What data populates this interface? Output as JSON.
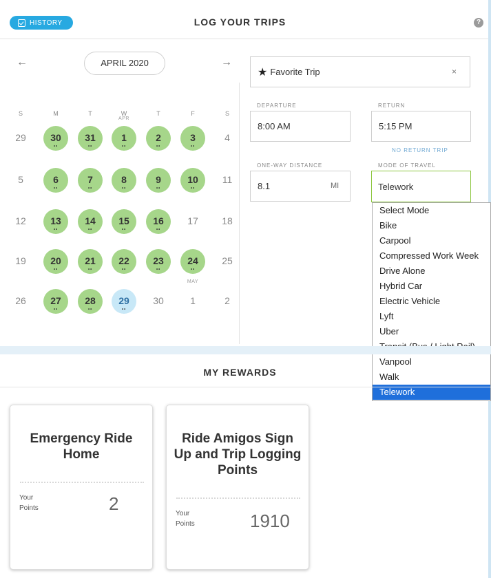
{
  "header": {
    "history_label": "HISTORY",
    "title": "LOG YOUR TRIPS",
    "help_glyph": "?"
  },
  "calendar": {
    "month_label": "APRIL 2020",
    "prev_glyph": "←",
    "next_glyph": "→",
    "weekdays": [
      "S",
      "M",
      "T",
      "W",
      "T",
      "F",
      "S"
    ],
    "logged_color": "#a6d68a",
    "today_color": "#c8e8f7",
    "weeks": [
      [
        {
          "d": "29",
          "s": "plain"
        },
        {
          "d": "30",
          "s": "logged"
        },
        {
          "d": "31",
          "s": "logged"
        },
        {
          "d": "1",
          "s": "logged",
          "m": "APR"
        },
        {
          "d": "2",
          "s": "logged"
        },
        {
          "d": "3",
          "s": "logged"
        },
        {
          "d": "4",
          "s": "plain"
        }
      ],
      [
        {
          "d": "5",
          "s": "plain"
        },
        {
          "d": "6",
          "s": "logged"
        },
        {
          "d": "7",
          "s": "logged"
        },
        {
          "d": "8",
          "s": "logged"
        },
        {
          "d": "9",
          "s": "logged"
        },
        {
          "d": "10",
          "s": "logged"
        },
        {
          "d": "11",
          "s": "plain"
        }
      ],
      [
        {
          "d": "12",
          "s": "plain"
        },
        {
          "d": "13",
          "s": "logged"
        },
        {
          "d": "14",
          "s": "logged"
        },
        {
          "d": "15",
          "s": "logged"
        },
        {
          "d": "16",
          "s": "logged"
        },
        {
          "d": "17",
          "s": "plain"
        },
        {
          "d": "18",
          "s": "plain"
        }
      ],
      [
        {
          "d": "19",
          "s": "plain"
        },
        {
          "d": "20",
          "s": "logged"
        },
        {
          "d": "21",
          "s": "logged"
        },
        {
          "d": "22",
          "s": "logged"
        },
        {
          "d": "23",
          "s": "logged"
        },
        {
          "d": "24",
          "s": "logged"
        },
        {
          "d": "25",
          "s": "plain"
        }
      ],
      [
        {
          "d": "26",
          "s": "plain"
        },
        {
          "d": "27",
          "s": "logged"
        },
        {
          "d": "28",
          "s": "logged"
        },
        {
          "d": "29",
          "s": "today"
        },
        {
          "d": "30",
          "s": "plain"
        },
        {
          "d": "1",
          "s": "plain",
          "m": "MAY"
        },
        {
          "d": "2",
          "s": "plain"
        }
      ]
    ]
  },
  "trip_form": {
    "favorite_label": "Favorite Trip",
    "favorite_clear": "×",
    "departure_label": "DEPARTURE",
    "departure_value": "8:00 AM",
    "return_label": "RETURN",
    "return_value": "5:15 PM",
    "no_return_link": "NO RETURN TRIP",
    "distance_label": "ONE-WAY DISTANCE",
    "distance_value": "8.1",
    "distance_unit": "MI",
    "mode_label": "MODE OF TRAVEL",
    "mode_value": "Telework",
    "mode_border_color": "#8cc63f"
  },
  "mode_options": [
    "Select Mode",
    "Bike",
    "Carpool",
    "Compressed Work Week",
    "Drive Alone",
    "Hybrid Car",
    "Electric Vehicle",
    "Lyft",
    "Uber",
    "Transit (Bus / Light Rail)",
    "Vanpool",
    "Walk",
    "Telework"
  ],
  "mode_selected": "Telework",
  "rewards": {
    "title": "MY REWARDS",
    "cards": [
      {
        "title": "Emergency Ride Home",
        "points_label": "Your Points",
        "points": "2"
      },
      {
        "title": "Ride Amigos Sign Up and Trip Logging Points",
        "points_label": "Your Points",
        "points": "1910"
      }
    ]
  }
}
